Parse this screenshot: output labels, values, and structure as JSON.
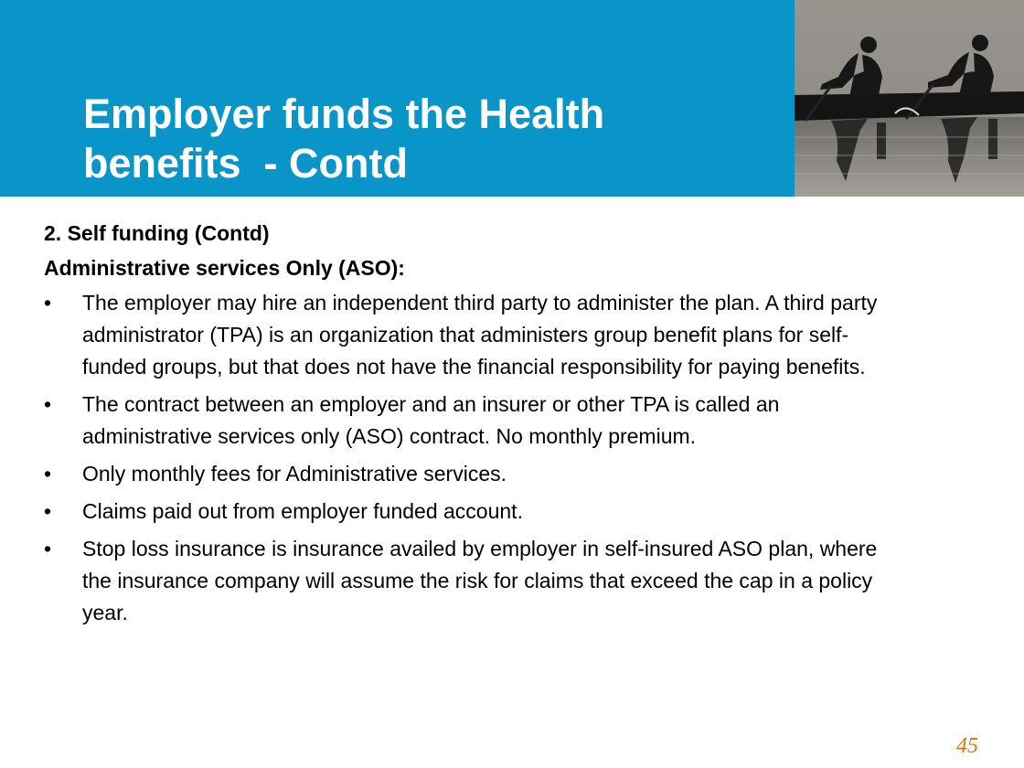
{
  "slide": {
    "title_lines": [
      "Employer funds the Health",
      "benefits  - Contd"
    ],
    "page_number": "45"
  },
  "header": {
    "image_alt": "two-rowers-silhouette",
    "bg_color": "#0a95c8"
  },
  "body": {
    "heading1": "2. Self funding (Contd)",
    "heading2": "Administrative services Only (ASO):",
    "bullet_symbol": "•",
    "bullets": [
      "The employer may hire an independent third party to administer the plan. A third party administrator (TPA) is an organization that administers group benefit plans for self-funded groups, but that does not have the financial responsibility for paying benefits.",
      "The contract between an employer and an insurer or other TPA is called an administrative services only (ASO) contract. No monthly premium.",
      "Only monthly fees for Administrative services.",
      "Claims paid out from employer funded account.",
      "Stop loss insurance is insurance availed by employer in self-insured ASO plan, where the insurance company will assume the risk for claims that exceed the cap in a policy year."
    ]
  },
  "colors": {
    "accent_blue": "#0a95c8",
    "page_number": "#d9731d"
  }
}
